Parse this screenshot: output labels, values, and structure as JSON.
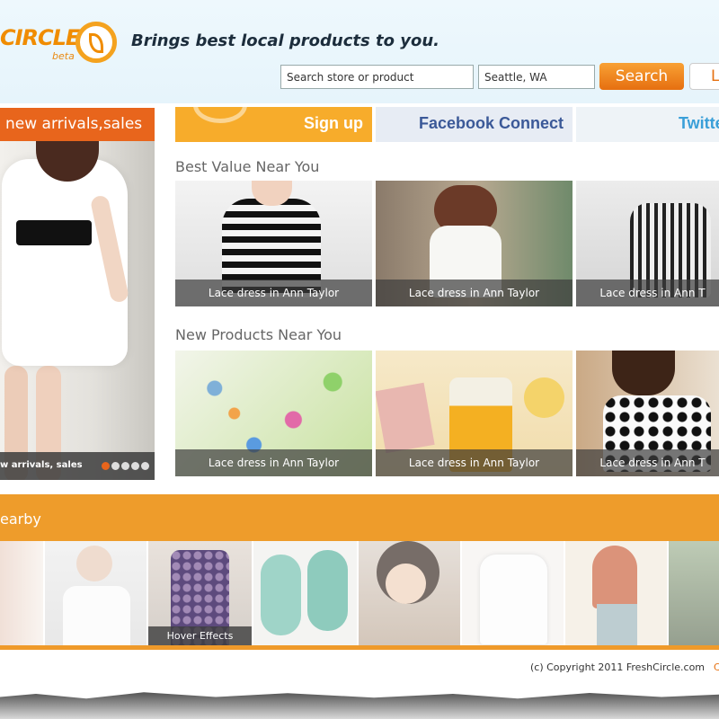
{
  "header": {
    "logo_text": "CIRCLE",
    "logo_sub": "beta",
    "tagline": "Brings best local products to you.",
    "search": {
      "value": "Search store or product"
    },
    "location": {
      "value": "Seattle, WA"
    },
    "search_button": "Search",
    "login_button": "L"
  },
  "featured": {
    "header": "new arrivals,sales",
    "caption": "w arrivals, sales",
    "slide_count": 5,
    "active_slide": 1
  },
  "connect": {
    "signup": "Sign up",
    "facebook": "Facebook Connect",
    "twitter": "Twitte"
  },
  "sections": {
    "best_value": {
      "title": "Best Value Near You",
      "items": [
        {
          "caption": "Lace dress in Ann Taylor"
        },
        {
          "caption": "Lace dress in Ann Taylor"
        },
        {
          "caption": "Lace dress in Ann T"
        }
      ]
    },
    "new_products": {
      "title": "New Products Near You",
      "items": [
        {
          "caption": "Lace dress in Ann Taylor"
        },
        {
          "caption": "Lace dress in Ann Taylor"
        },
        {
          "caption": "Lace dress in Ann T"
        }
      ]
    }
  },
  "nearby": {
    "title": "earby",
    "hover_caption": "Hover Effects"
  },
  "footer": {
    "copyright": "(c) Copyright 2011 FreshCircle.com",
    "accent": "C"
  },
  "colors": {
    "brand_orange": "#e8651c",
    "accent_orange": "#f7ac2b",
    "facebook_blue": "#3b5998",
    "twitter_blue": "#3a9fd8"
  }
}
